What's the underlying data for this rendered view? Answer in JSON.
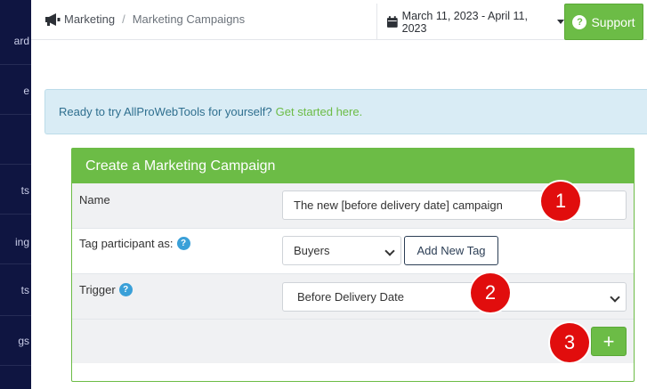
{
  "sidebar": {
    "items": [
      {
        "label": "ard"
      },
      {
        "label": "e"
      },
      {
        "label": ""
      },
      {
        "label": "ts"
      },
      {
        "label": "ing"
      },
      {
        "label": "ts"
      },
      {
        "label": "gs"
      }
    ]
  },
  "breadcrumb": {
    "items": [
      "Marketing",
      "Marketing Campaigns"
    ],
    "separator": "/"
  },
  "date_range": {
    "label": "March 11, 2023 - April 11, 2023"
  },
  "support": {
    "label": "Support"
  },
  "alert": {
    "text": "Ready to try AllProWebTools for yourself?",
    "link": "Get started here."
  },
  "panel": {
    "title": "Create a Marketing Campaign",
    "name_label": "Name",
    "name_value": "The new [before delivery date] campaign",
    "tag_label": "Tag participant as:",
    "tag_value": "Buyers",
    "add_tag_label": "Add New Tag",
    "trigger_label": "Trigger",
    "trigger_value": "Before Delivery Date",
    "add_label": "+"
  },
  "callouts": [
    "1",
    "2",
    "3"
  ],
  "colors": {
    "accent": "#6cbc46",
    "sidebar": "#0f1541",
    "alert_bg": "#d9ecf5",
    "badge": "#e10d0d",
    "help": "#3aa0d8"
  }
}
